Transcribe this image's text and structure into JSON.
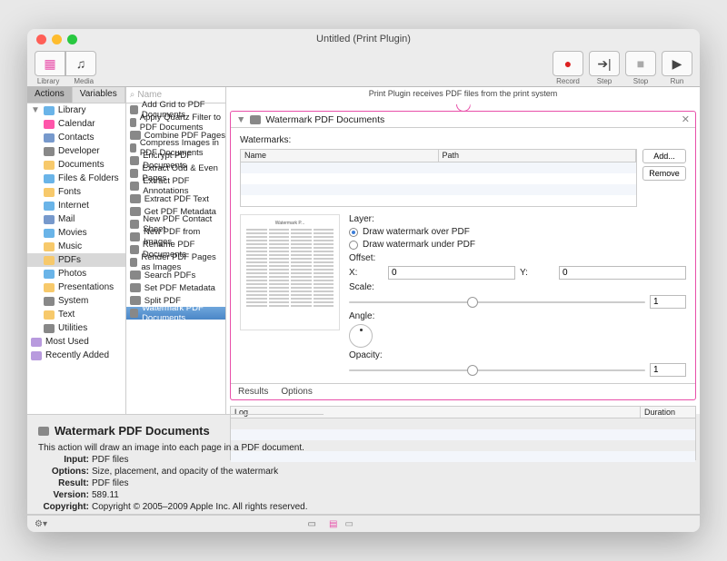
{
  "title": "Untitled (Print Plugin)",
  "toolbar": {
    "library": "Library",
    "media": "Media",
    "record": "Record",
    "step": "Step",
    "stop": "Stop",
    "run": "Run"
  },
  "tabs": {
    "actions": "Actions",
    "variables": "Variables"
  },
  "search_placeholder": "Name",
  "library": {
    "root": "Library",
    "items": [
      "Calendar",
      "Contacts",
      "Developer",
      "Documents",
      "Files & Folders",
      "Fonts",
      "Internet",
      "Mail",
      "Movies",
      "Music",
      "PDFs",
      "Photos",
      "Presentations",
      "System",
      "Text",
      "Utilities"
    ],
    "extras": [
      "Most Used",
      "Recently Added"
    ]
  },
  "actions": [
    "Add Grid to PDF Documents",
    "Apply Quartz Filter to PDF Documents",
    "Combine PDF Pages",
    "Compress Images in PDF Documents",
    "Encrypt PDF Documents",
    "Extract Odd & Even Pages",
    "Extract PDF Annotations",
    "Extract PDF Text",
    "Get PDF Metadata",
    "New PDF Contact Sheet",
    "New PDF from Images",
    "Rename PDF Documents",
    "Render PDF Pages as Images",
    "Search PDFs",
    "Set PDF Metadata",
    "Split PDF",
    "Watermark PDF Documents"
  ],
  "selected_action_index": 16,
  "flow_header": "Print Plugin receives PDF files from the print system",
  "card": {
    "title": "Watermark PDF Documents",
    "watermarks_label": "Watermarks:",
    "cols": {
      "name": "Name",
      "path": "Path"
    },
    "add": "Add...",
    "remove": "Remove",
    "layer_label": "Layer:",
    "layer_over": "Draw watermark over PDF",
    "layer_under": "Draw watermark under PDF",
    "offset_label": "Offset:",
    "x_label": "X:",
    "x_val": "0",
    "y_label": "Y:",
    "y_val": "0",
    "scale_label": "Scale:",
    "scale_val": "1",
    "angle_label": "Angle:",
    "opacity_label": "Opacity:",
    "opacity_val": "1",
    "results": "Results",
    "options": "Options"
  },
  "log": {
    "log": "Log",
    "duration": "Duration"
  },
  "description": {
    "title": "Watermark PDF Documents",
    "body": "This action will draw an image into each page in a PDF document.",
    "input_l": "Input:",
    "input_v": "PDF files",
    "options_l": "Options:",
    "options_v": "Size, placement, and opacity of the watermark",
    "result_l": "Result:",
    "result_v": "PDF files",
    "version_l": "Version:",
    "version_v": "589.11",
    "copyright_l": "Copyright:",
    "copyright_v": "Copyright © 2005–2009 Apple Inc.  All rights reserved."
  }
}
